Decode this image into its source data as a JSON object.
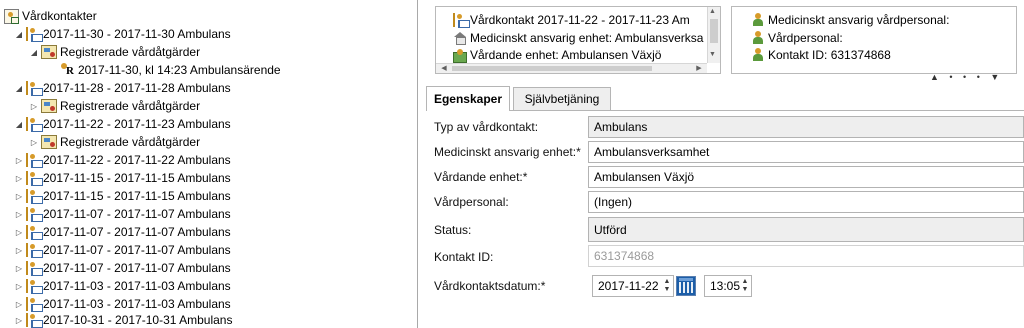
{
  "tree": {
    "root_label": "Vårdkontakter",
    "items": [
      {
        "label": "2017-11-30  -  2017-11-30  Ambulans"
      },
      {
        "label": "Registrerade vårdåtgärder"
      },
      {
        "label": "2017-11-30, kl 14:23  Ambulansärende"
      },
      {
        "label": "2017-11-28  -  2017-11-28  Ambulans"
      },
      {
        "label": "Registrerade vårdåtgärder"
      },
      {
        "label": "2017-11-22  -  2017-11-23  Ambulans"
      },
      {
        "label": "Registrerade vårdåtgärder"
      },
      {
        "label": "2017-11-22  -  2017-11-22  Ambulans"
      },
      {
        "label": "2017-11-15  -  2017-11-15  Ambulans"
      },
      {
        "label": "2017-11-15  -  2017-11-15  Ambulans"
      },
      {
        "label": "2017-11-07  -  2017-11-07  Ambulans"
      },
      {
        "label": "2017-11-07  -  2017-11-07  Ambulans"
      },
      {
        "label": "2017-11-07  -  2017-11-07  Ambulans"
      },
      {
        "label": "2017-11-07  -  2017-11-07  Ambulans"
      },
      {
        "label": "2017-11-03  -  2017-11-03  Ambulans"
      },
      {
        "label": "2017-11-03  -  2017-11-03  Ambulans"
      },
      {
        "label": "2017-10-31  -  2017-10-31  Ambulans"
      }
    ]
  },
  "info_left": {
    "line1": "Vårdkontakt 2017-11-22  -  2017-11-23  Am",
    "line2": "Medicinskt ansvarig enhet: Ambulansverksa",
    "line3": "Vårdande enhet: Ambulansen Växjö"
  },
  "info_right": {
    "line1": "Medicinskt ansvarig vårdpersonal:",
    "line2": "Vårdpersonal:",
    "line3": "Kontakt ID: 631374868"
  },
  "pager": "▲ • • • ▼",
  "tabs": [
    {
      "label": "Egenskaper"
    },
    {
      "label": "Självbetjäning"
    }
  ],
  "form": {
    "type_label": "Typ av vårdkontakt:",
    "type_value": "Ambulans",
    "med_unit_label": "Medicinskt ansvarig enhet:*",
    "med_unit_value": "Ambulansverksamhet",
    "care_unit_label": "Vårdande enhet:*",
    "care_unit_value": "Ambulansen Växjö",
    "staff_label": "Vårdpersonal:",
    "staff_value": "(Ingen)",
    "status_label": "Status:",
    "status_value": "Utförd",
    "contact_id_label": "Kontakt ID:",
    "contact_id_value": "631374868",
    "date_label": "Vårdkontaktsdatum:*",
    "date_value": "2017-11-22",
    "time_value": "13:05"
  }
}
